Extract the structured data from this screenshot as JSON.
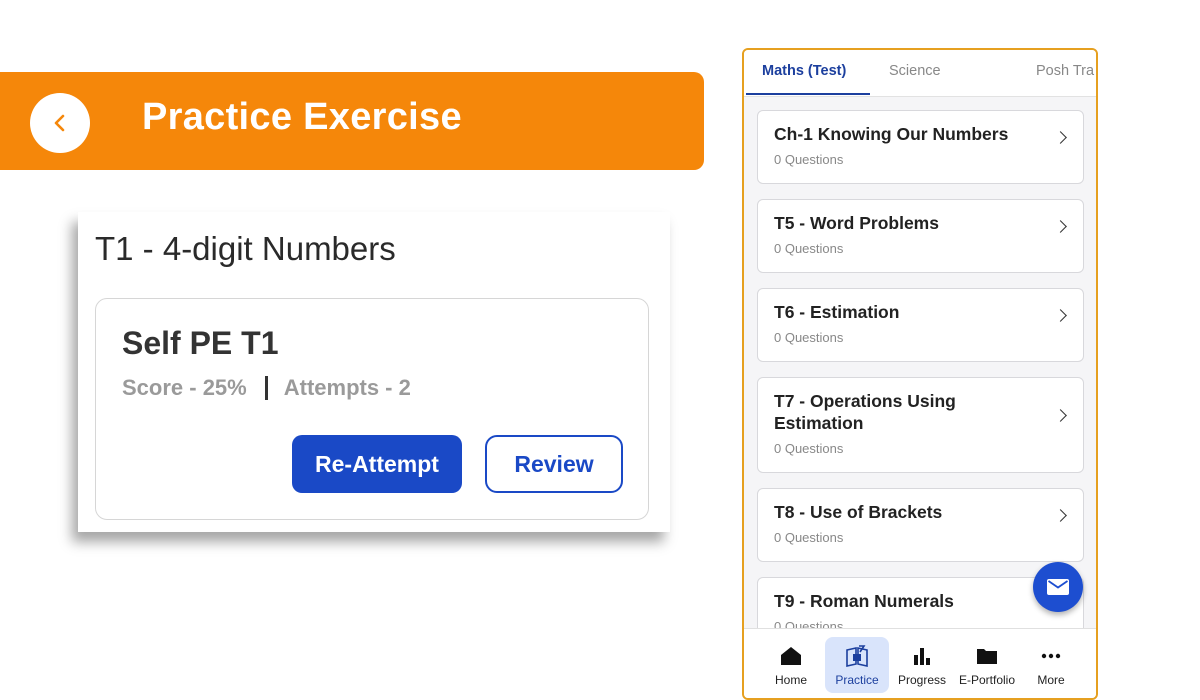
{
  "header": {
    "title": "Practice Exercise"
  },
  "exercise": {
    "topic": "T1 - 4-digit Numbers",
    "card_title": "Self PE T1",
    "score": "Score - 25%",
    "attempts": "Attempts - 2",
    "reattempt_label": "Re-Attempt",
    "review_label": "Review"
  },
  "tabs": [
    {
      "label": "Maths (Test)",
      "active": true
    },
    {
      "label": "Science"
    },
    {
      "label": "Posh Tra"
    }
  ],
  "chapters": [
    {
      "title": "Ch-1 Knowing Our Numbers",
      "sub": "0 Questions"
    },
    {
      "title": "T5 - Word Problems",
      "sub": "0 Questions"
    },
    {
      "title": "T6 - Estimation",
      "sub": "0 Questions"
    },
    {
      "title": "T7 - Operations Using Estimation",
      "sub": "0 Questions"
    },
    {
      "title": "T8 - Use of Brackets",
      "sub": "0 Questions"
    },
    {
      "title": "T9 - Roman Numerals",
      "sub": "0 Questions"
    }
  ],
  "fab_icon": "mail-icon",
  "nav": [
    {
      "label": "Home",
      "icon": "home-icon"
    },
    {
      "label": "Practice",
      "icon": "practice-icon",
      "active": true
    },
    {
      "label": "Progress",
      "icon": "bar-chart-icon"
    },
    {
      "label": "E-Portfolio",
      "icon": "folder-icon"
    },
    {
      "label": "More",
      "icon": "more-icon"
    }
  ],
  "colors": {
    "brand_orange": "#f5870a",
    "primary_blue": "#1a49c6",
    "active_nav_bg": "#d9e4fb"
  }
}
